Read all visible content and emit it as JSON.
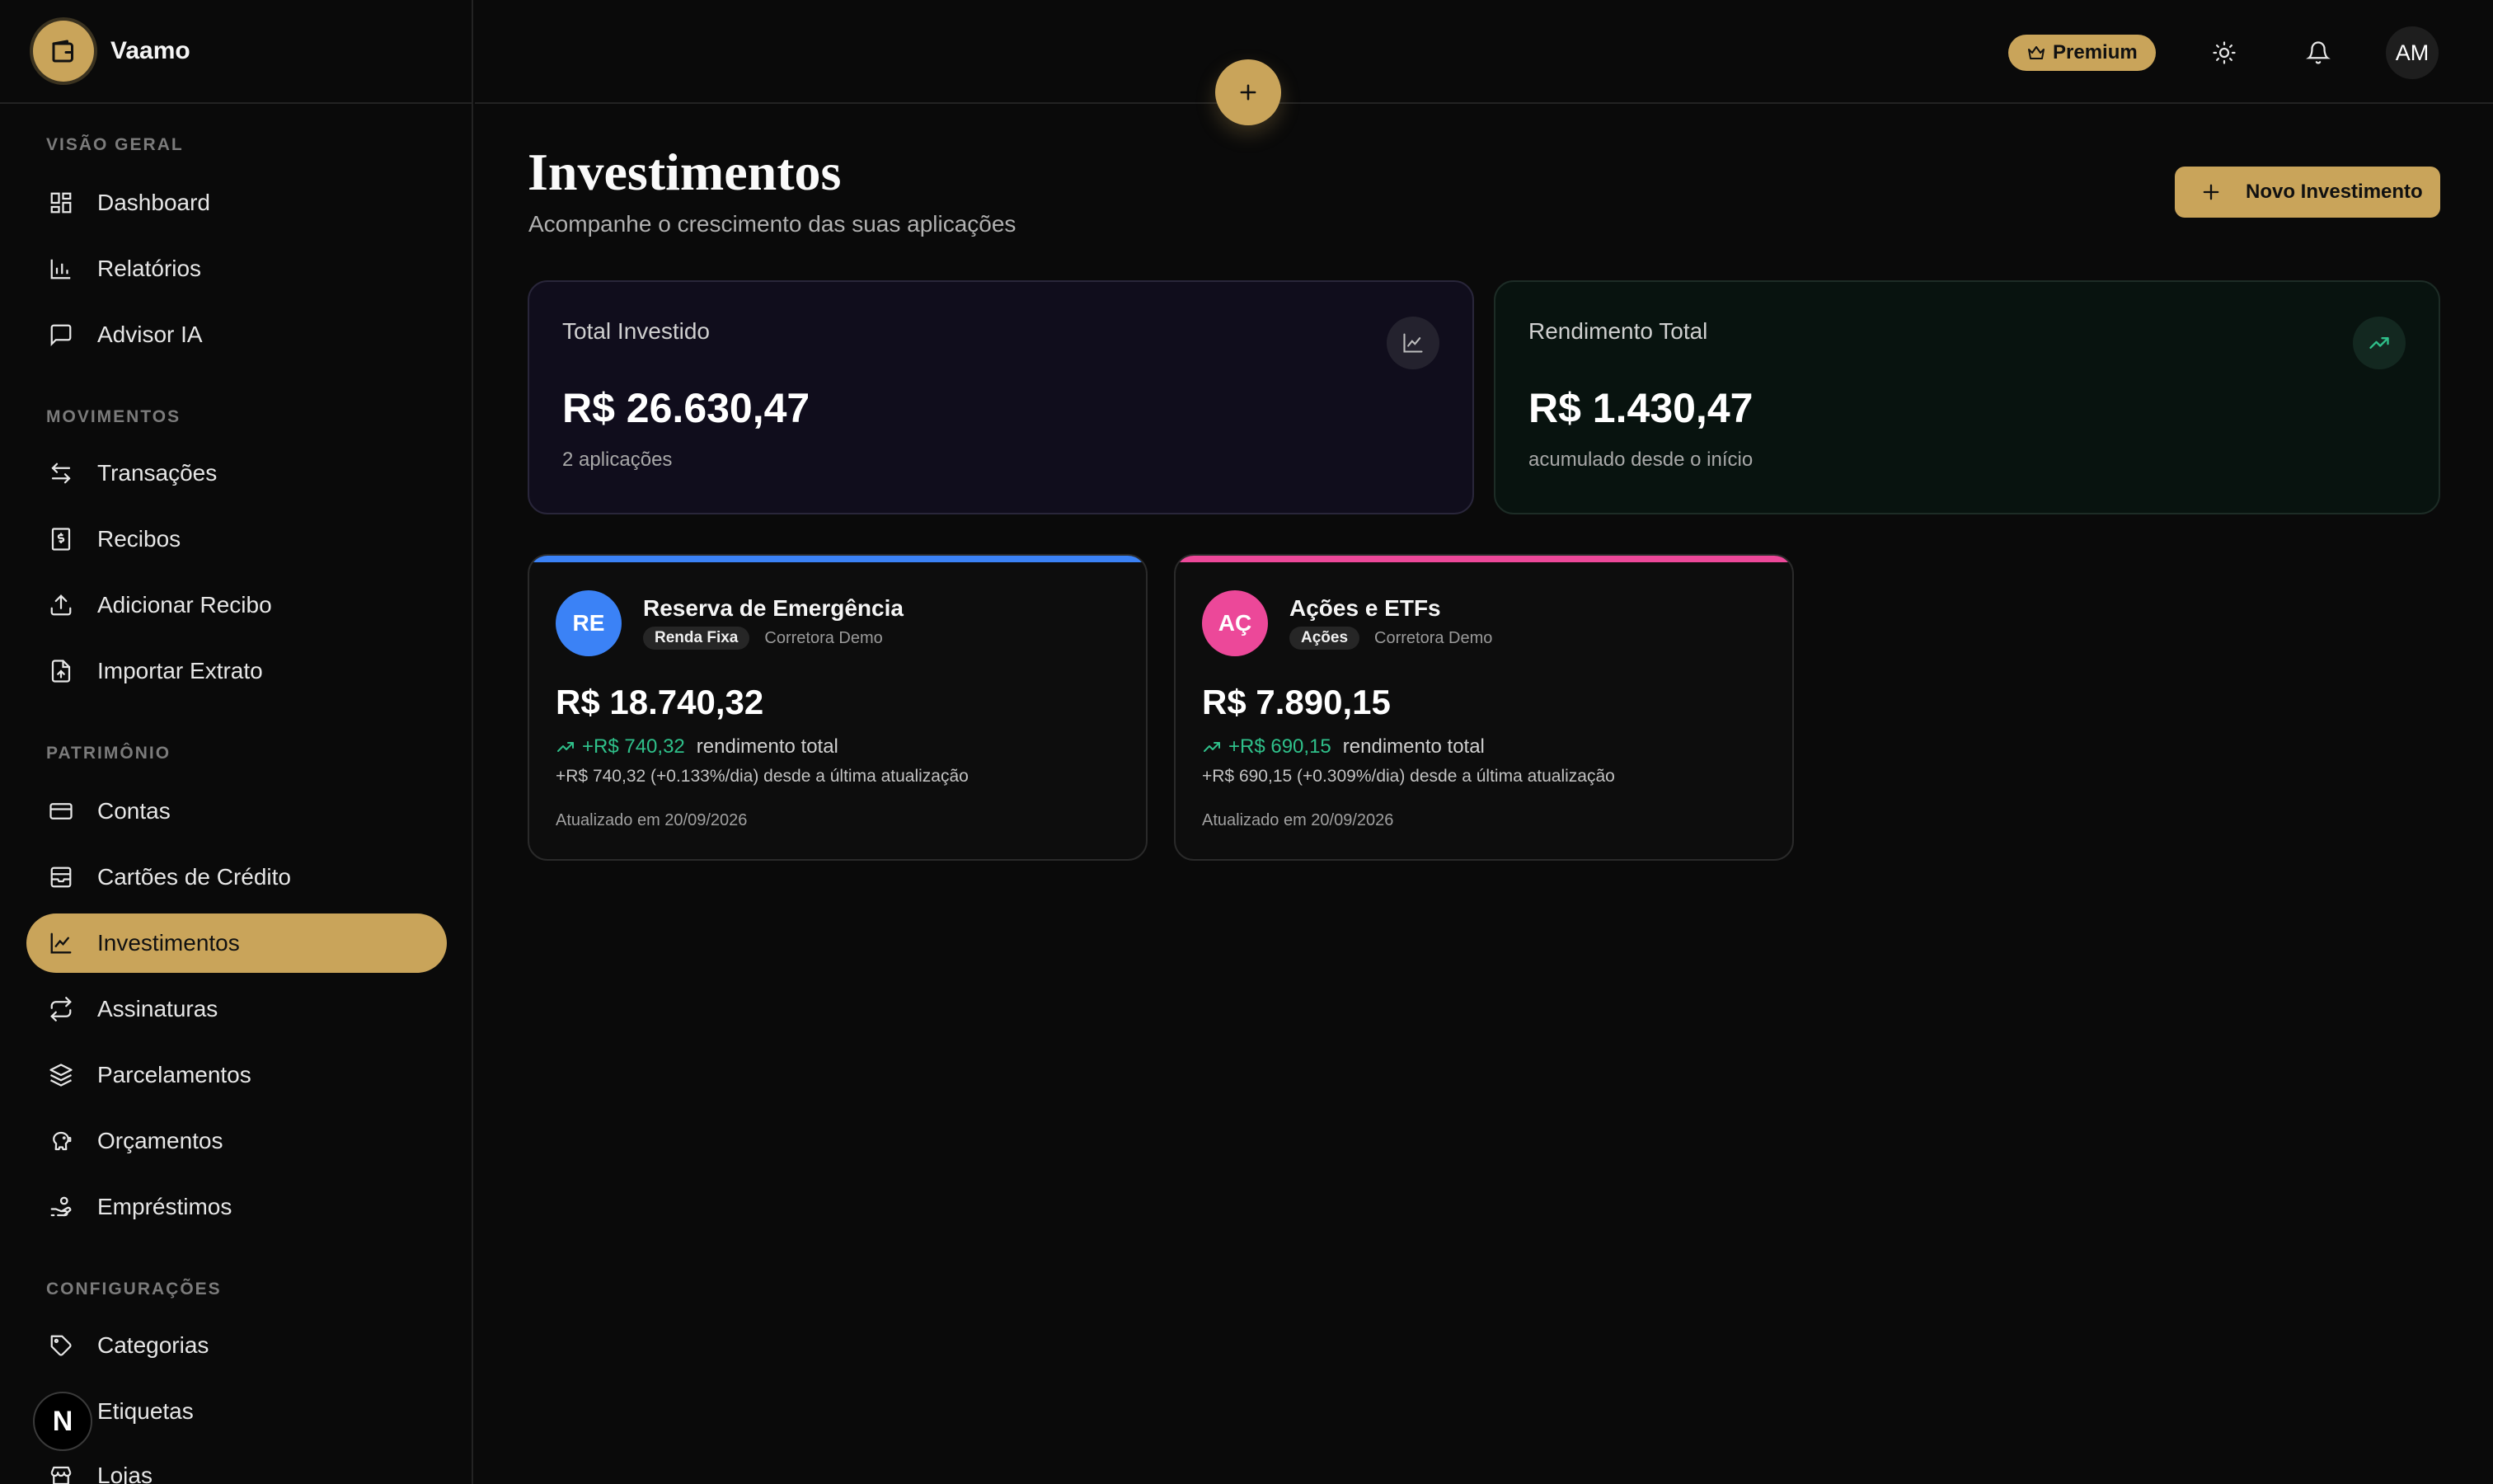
{
  "brand": {
    "name": "Vaamo"
  },
  "sidebar": {
    "sections": [
      {
        "title": "VISÃO GERAL",
        "items": [
          "Dashboard",
          "Relatórios",
          "Advisor IA"
        ]
      },
      {
        "title": "MOVIMENTOS",
        "items": [
          "Transações",
          "Recibos",
          "Adicionar Recibo",
          "Importar Extrato"
        ]
      },
      {
        "title": "PATRIMÔNIO",
        "items": [
          "Contas",
          "Cartões de Crédito",
          "Investimentos",
          "Assinaturas",
          "Parcelamentos",
          "Orçamentos",
          "Empréstimos"
        ]
      },
      {
        "title": "CONFIGURAÇÕES",
        "items": [
          "Categorias",
          "Etiquetas",
          "Lojas"
        ]
      }
    ],
    "active_item": "Investimentos",
    "badge_letter": "N"
  },
  "topbar": {
    "premium_label": "Premium",
    "avatar_initials": "AM"
  },
  "main": {
    "title": "Investimentos",
    "subtitle": "Acompanhe o crescimento das suas aplicações",
    "new_button_label": "Novo Investimento",
    "stats": {
      "invested": {
        "label": "Total Investido",
        "value": "R$ 26.630,47",
        "sub": "2 aplicações"
      },
      "yield": {
        "label": "Rendimento Total",
        "value": "R$ 1.430,47",
        "sub": "acumulado desde o início"
      }
    },
    "investments": [
      {
        "initials": "RE",
        "name": "Reserva de Emergência",
        "tag": "Renda Fixa",
        "broker": "Corretora Demo",
        "value": "R$ 18.740,32",
        "gain": "+R$ 740,32",
        "gain_label": "rendimento total",
        "detail": "+R$ 740,32 (+0.133%/dia) desde a última atualização",
        "updated": "Atualizado em 20/09/2026",
        "color": "#3b82f6"
      },
      {
        "initials": "AÇ",
        "name": "Ações e ETFs",
        "tag": "Ações",
        "broker": "Corretora Demo",
        "value": "R$ 7.890,15",
        "gain": "+R$ 690,15",
        "gain_label": "rendimento total",
        "detail": "+R$ 690,15 (+0.309%/dia) desde a última atualização",
        "updated": "Atualizado em 20/09/2026",
        "color": "#ec4899"
      }
    ]
  },
  "colors": {
    "accent": "#c9a45a",
    "positive": "#2fc08a",
    "background": "#0a0a0a"
  }
}
